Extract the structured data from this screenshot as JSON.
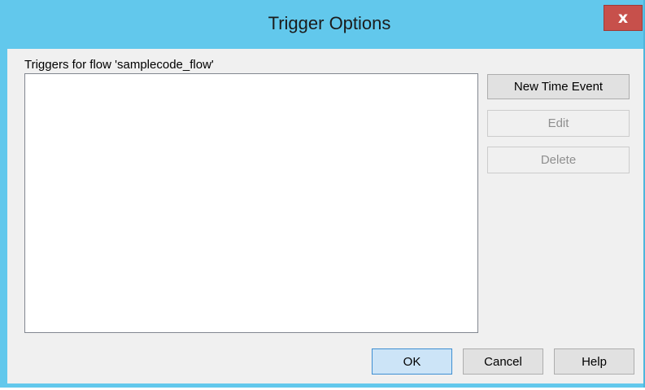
{
  "window": {
    "title": "Trigger Options",
    "close_glyph": "x"
  },
  "list": {
    "label": "Triggers for flow 'samplecode_flow'",
    "items": []
  },
  "side_buttons": {
    "new_time_event": "New Time Event",
    "edit": "Edit",
    "delete": "Delete"
  },
  "footer_buttons": {
    "ok": "OK",
    "cancel": "Cancel",
    "help": "Help"
  },
  "colors": {
    "titlebar": "#62c8ec",
    "close_button": "#c7504b",
    "default_button": "#cce4f7"
  }
}
